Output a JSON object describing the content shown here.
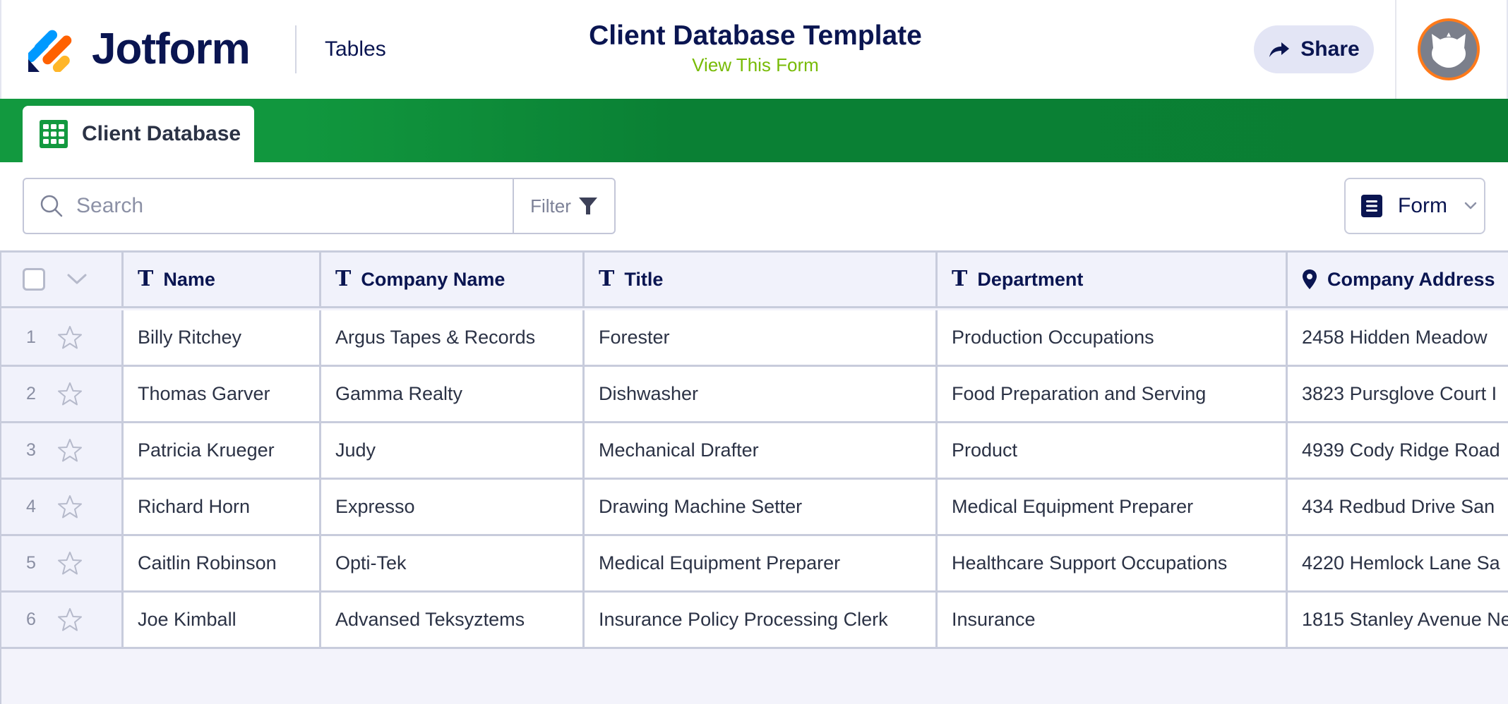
{
  "header": {
    "brand": "Jotform",
    "section": "Tables",
    "title": "Client Database Template",
    "subtitle_link": "View This Form",
    "share_label": "Share",
    "logo_icon": "jotform-logo-icon",
    "avatar_icon": "cat-avatar-icon"
  },
  "tabs": [
    {
      "label": "Client Database",
      "icon": "table-grid-icon",
      "active": true
    }
  ],
  "toolbar": {
    "search_placeholder": "Search",
    "search_value": "",
    "filter_label": "Filter",
    "view_label": "Form"
  },
  "table": {
    "columns": [
      {
        "label": "Name",
        "icon": "text-type-icon"
      },
      {
        "label": "Company Name",
        "icon": "text-type-icon"
      },
      {
        "label": "Title",
        "icon": "text-type-icon"
      },
      {
        "label": "Department",
        "icon": "text-type-icon"
      },
      {
        "label": "Company Address",
        "icon": "location-pin-icon"
      }
    ],
    "rows": [
      {
        "num": "1",
        "cells": [
          "Billy Ritchey",
          "Argus Tapes & Records",
          "Forester",
          "Production Occupations",
          "2458 Hidden Meadow"
        ]
      },
      {
        "num": "2",
        "cells": [
          "Thomas Garver",
          "Gamma Realty",
          "Dishwasher",
          "Food Preparation and Serving",
          "3823 Pursglove Court I"
        ]
      },
      {
        "num": "3",
        "cells": [
          "Patricia Krueger",
          "Judy",
          "Mechanical Drafter",
          "Product",
          "4939 Cody Ridge Road"
        ]
      },
      {
        "num": "4",
        "cells": [
          "Richard Horn",
          "Expresso",
          "Drawing Machine Setter",
          "Medical Equipment Preparer",
          "434 Redbud Drive San"
        ]
      },
      {
        "num": "5",
        "cells": [
          "Caitlin Robinson",
          "Opti-Tek",
          "Medical Equipment Preparer",
          "Healthcare Support Occupations",
          "4220 Hemlock Lane Sa"
        ]
      },
      {
        "num": "6",
        "cells": [
          "Joe Kimball",
          "Advansed Teksyztems",
          "Insurance Policy Processing Clerk",
          "Insurance",
          "1815 Stanley Avenue Ne"
        ]
      }
    ]
  },
  "colors": {
    "brand_navy": "#0a1551",
    "link_green": "#78bb07",
    "bar_green_start": "#12993f",
    "bar_green_end": "#0a7f33",
    "avatar_ring": "#ff7a1a"
  }
}
